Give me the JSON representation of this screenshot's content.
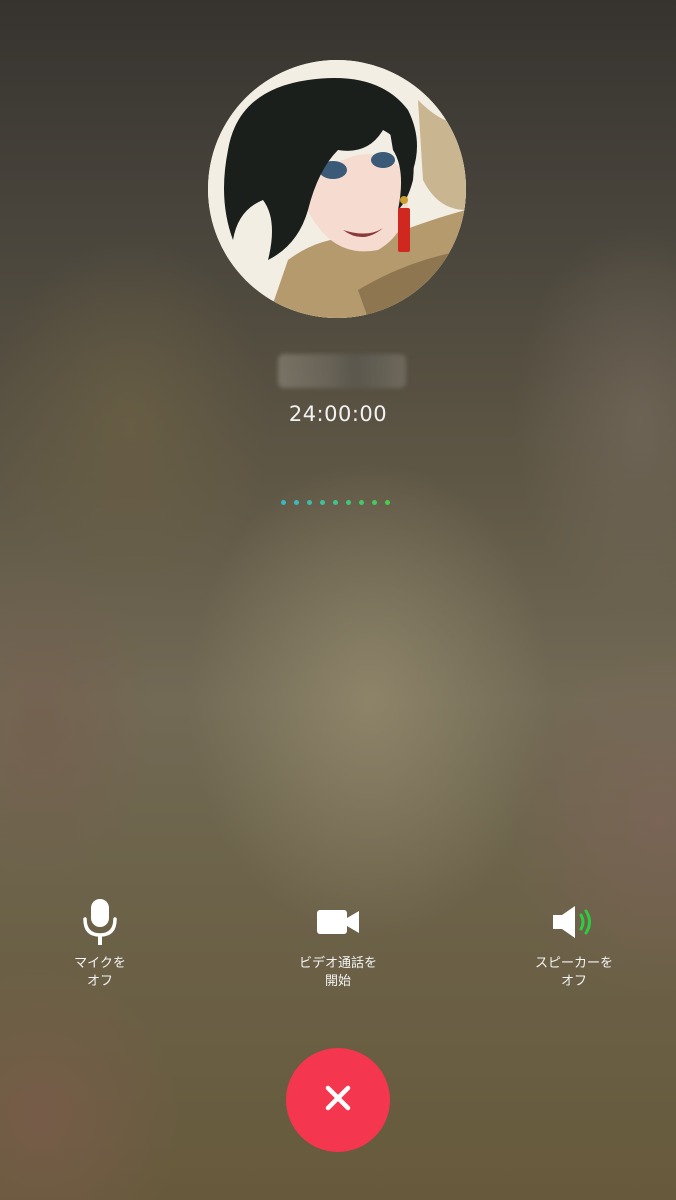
{
  "call": {
    "caller_name": "■■■■■",
    "duration": "24:00:00"
  },
  "status_indicator": {
    "dot_colors": [
      "#3bb7c4",
      "#3cbab7",
      "#3dbda9",
      "#3ec09b",
      "#40c38c",
      "#42c57d",
      "#43c86e",
      "#45cb5f",
      "#47ce50"
    ]
  },
  "controls": {
    "mute": {
      "icon": "microphone-icon",
      "label_line1": "マイクを",
      "label_line2": "オフ"
    },
    "video": {
      "icon": "video-camera-icon",
      "label_line1": "ビデオ通話を",
      "label_line2": "開始"
    },
    "speaker": {
      "icon": "speaker-icon",
      "label_line1": "スピーカーを",
      "label_line2": "オフ"
    }
  },
  "end_call": {
    "icon": "close-icon"
  },
  "colors": {
    "end_call_red": "#f4364f",
    "speaker_wave_green": "#2ecc40",
    "avatar_border": "#ffffff"
  }
}
